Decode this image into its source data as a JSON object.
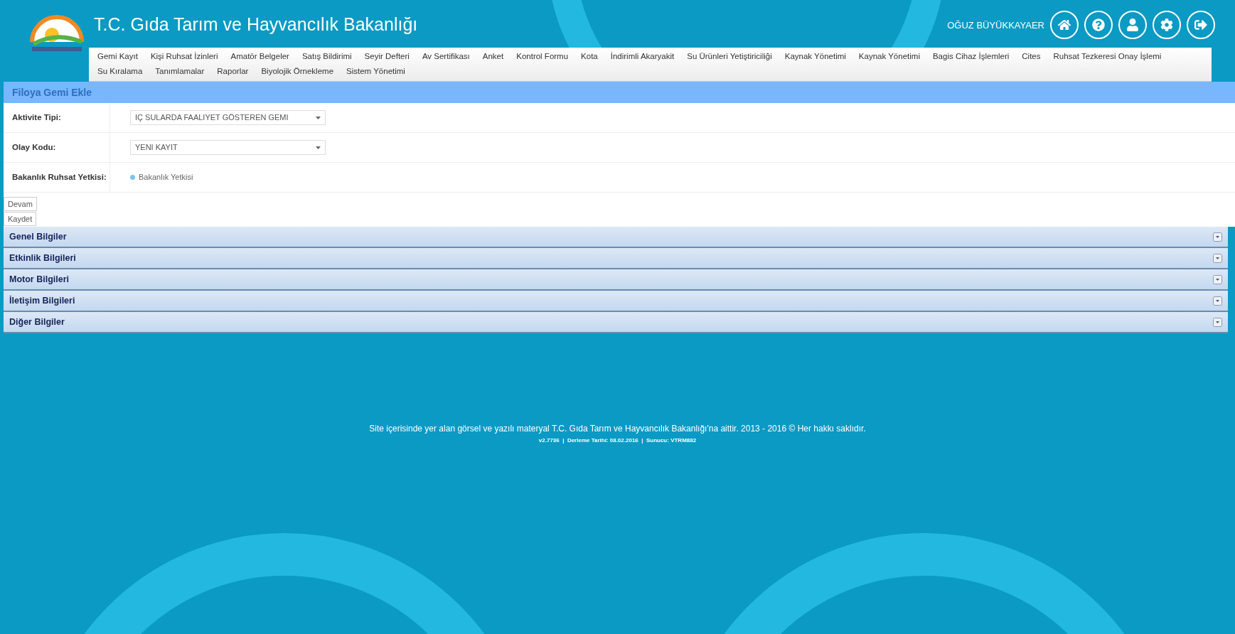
{
  "header": {
    "title": "T.C. Gıda Tarım ve Hayvancılık Bakanlığı",
    "user": "OĞUZ BÜYÜKKAYAER"
  },
  "nav": {
    "rows": [
      [
        "Gemi Kayıt",
        "Kişi Ruhsat İzinleri",
        "Amatör Belgeler",
        "Satış Bildirimi",
        "Seyir Defteri",
        "Av Sertifikası",
        "Anket",
        "Kontrol Formu",
        "Kota",
        "İndirimli Akaryakit",
        "Su Ürünleri Yetiştiriciliği",
        "Kaynak Yönetimi",
        "Kaynak Yönetimi",
        "Bagis Cihaz İşlemleri",
        "Cites",
        "Ruhsat Tezkeresi Onay İşlemi"
      ],
      [
        "Su Kıralama",
        "Tanımlamalar",
        "Raporlar",
        "Biyolojik Örnekleme",
        "Sistem Yönetimi"
      ]
    ]
  },
  "form": {
    "title": "Filoya Gemi Ekle",
    "fields": [
      {
        "kind": "select",
        "label": "Aktivite Tipi:",
        "value": "IÇ SULARDA FAALIYET GÖSTEREN GEMI"
      },
      {
        "kind": "select",
        "label": "Olay Kodu:",
        "value": "YENI KAYIT"
      },
      {
        "kind": "radio",
        "label": "Bakanlık Ruhsat Yetkisi:",
        "option": "Bakanlık Yetkisi",
        "checked": true
      }
    ]
  },
  "buttons": [
    "Devam",
    "Kaydet"
  ],
  "sections": [
    {
      "title": "Genel Bilgiler",
      "expanded": false
    },
    {
      "title": "Etkinlik Bilgileri",
      "expanded": false
    },
    {
      "title": "Motor Bilgileri",
      "expanded": false
    },
    {
      "title": "İletişim Bilgileri",
      "expanded": false
    },
    {
      "title": "Diğer Bilgiler",
      "expanded": false
    }
  ],
  "footer": {
    "copyright": "Site içerisinde yer alan görsel ve yazılı materyal T.C. Gıda Tarım ve Hayvancılık Bakanlığı'na aittir. 2013 - 2016 © Her hakkı saklıdır.",
    "build": "v2.7736  |  Derleme Tarihi: 08.02.2016  |  Sunucu: VTRM882"
  }
}
